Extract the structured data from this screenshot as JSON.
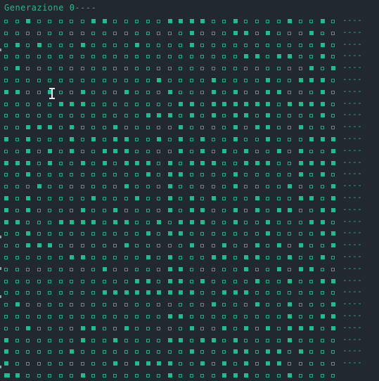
{
  "terminal": {
    "title": "Generazione 0----",
    "row_suffix": "----",
    "colors": {
      "background": "#222830",
      "text": "#2bb38a",
      "alive": "#1bbf8f",
      "dead_outline": "#27a884"
    },
    "grid": [
      "0010000011000001111001000010010",
      "0000000000000000010001101000100",
      "0101000100001000010000000000010",
      "0000000000000000000000110110010",
      "0100000000000000000000000000101",
      "0000000000000010000100001001110",
      "1100100100010001000101001100010",
      "0000011100000000110111111011110",
      "0000000000000111010101101000010",
      "0011101000100000100001011001000",
      "1010001010110010101001001000111",
      "0010101001110000101010100101001",
      "1110100101011101011100111001111",
      "0010000000000101100001000001010",
      "0001000000010001000001000010001",
      "1010000010001001010100010001101",
      "1010000100100001011001010110011",
      "1100011110110010111001001000110",
      "0010000000000101100000001000011",
      "0011100000010000010010010101001",
      "0000001100000101000110110010010",
      "0000000001000001100000100101100",
      "0000000000001101101000010010011",
      "0000000001111111110011100000000",
      "0100000000000000000100010010001",
      "0000000000000001100000000010011",
      "0010000110010000010010101011101",
      "1000000100100001101101000010000",
      "1000001000000000010001101101000",
      "1000000000101111001010101100000",
      "0100000100000001000011100010000"
    ]
  }
}
